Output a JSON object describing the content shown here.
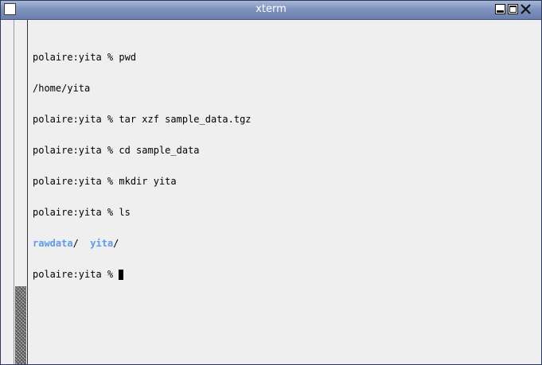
{
  "window": {
    "title": "xterm",
    "menu_icon": "window-menu-icon",
    "controls": {
      "minimize_icon": "minimize-icon",
      "maximize_icon": "maximize-icon",
      "close_icon": "close-icon"
    }
  },
  "terminal": {
    "lines": [
      "polaire:yita % pwd",
      "/home/yita",
      "polaire:yita % tar xzf sample_data.tgz",
      "polaire:yita % cd sample_data",
      "polaire:yita % mkdir yita",
      "polaire:yita % ls"
    ],
    "ls_output": [
      {
        "name": "rawdata",
        "suffix": "/"
      },
      {
        "name": "yita",
        "suffix": "/"
      }
    ],
    "ls_separator": "  ",
    "prompt": "polaire:yita % "
  },
  "colors": {
    "directory": "#5b9cf0",
    "titlebar": "#7f93bf",
    "background": "#efefef"
  }
}
